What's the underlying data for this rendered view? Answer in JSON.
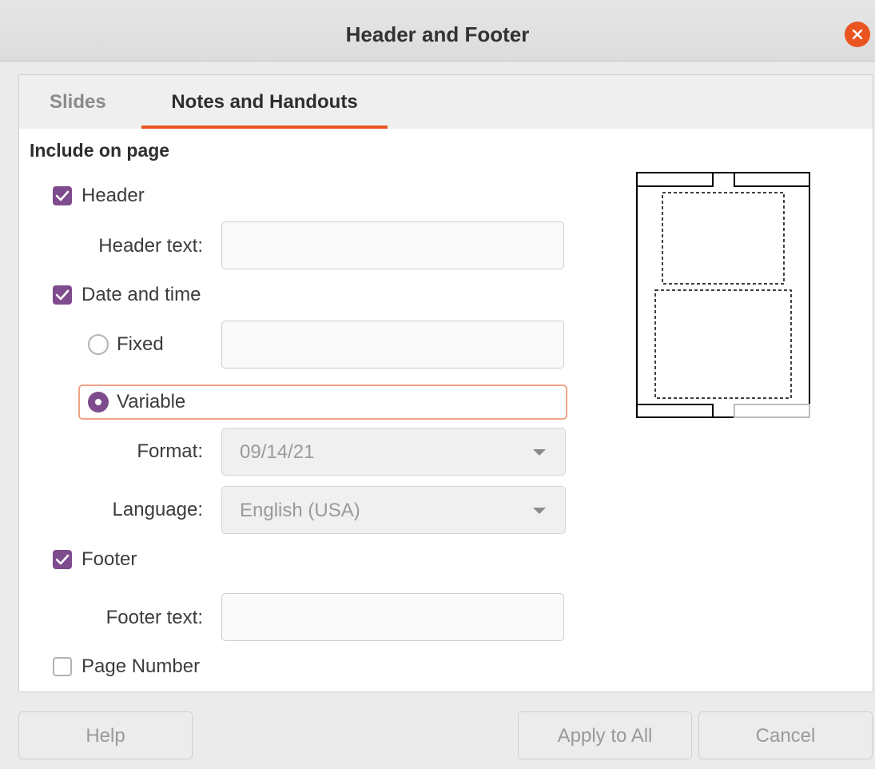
{
  "window": {
    "title": "Header and Footer"
  },
  "tabs": [
    {
      "label": "Slides",
      "active": false
    },
    {
      "label": "Notes and Handouts",
      "active": true
    }
  ],
  "section": {
    "title": "Include on page"
  },
  "header": {
    "checkbox_label": "Header",
    "checked": true,
    "text_label": "Header text:",
    "text_value": ""
  },
  "datetime": {
    "checkbox_label": "Date and time",
    "checked": true,
    "fixed_label": "Fixed",
    "fixed_selected": false,
    "fixed_value": "",
    "variable_label": "Variable",
    "variable_selected": true,
    "format_label": "Format:",
    "format_value": "09/14/21",
    "language_label": "Language:",
    "language_value": "English (USA)"
  },
  "footer": {
    "checkbox_label": "Footer",
    "checked": true,
    "text_label": "Footer text:",
    "text_value": ""
  },
  "page_number": {
    "checkbox_label": "Page Number",
    "checked": false
  },
  "buttons": {
    "help": "Help",
    "apply_all": "Apply to All",
    "cancel": "Cancel"
  },
  "colors": {
    "accent": "#e95420",
    "check": "#7e4b8c"
  }
}
